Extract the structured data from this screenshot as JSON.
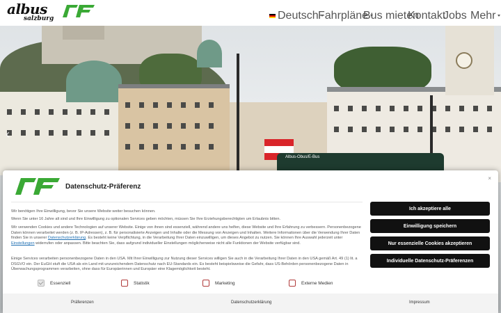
{
  "brand": {
    "logo_text": "albus",
    "logo_sub": "salzburg",
    "accent_green": "#3aa935",
    "logo_icon": "jf-logo-icon"
  },
  "nav": {
    "language": "Deutsch",
    "items": [
      "Fahrpläne",
      "Bus mieten",
      "Kontakt",
      "Jobs",
      "Mehr"
    ]
  },
  "hero": {
    "bus_display": "Albus-Obus/E-Bus"
  },
  "privacy": {
    "title": "Datenschutz-Präferenz",
    "close": "×",
    "p1": "Wir benötigen Ihre Einwilligung, bevor Sie unsere Website weiter besuchen können.",
    "p2": "Wenn Sie unter 16 Jahre alt sind und Ihre Einwilligung zu optionalen Services geben möchten, müssen Sie Ihre Erziehungsberechtigten um Erlaubnis bitten.",
    "p3_a": "Wir verwenden Cookies und andere Technologien auf unserer Website. Einige von ihnen sind essenziell, während andere uns helfen, diese Website und Ihre Erfahrung zu verbessern. Personenbezogene Daten können verarbeitet werden (z. B. IP-Adressen), z. B. für personalisierte Anzeigen und Inhalte oder die Messung von Anzeigen und Inhalten. Weitere Informationen über die Verwendung Ihrer Daten finden Sie in unserer",
    "p3_link1": "Datenschutzerklärung",
    "p3_b": ". Es besteht keine Verpflichtung, in die Verarbeitung Ihrer Daten einzuwilligen, um dieses Angebot zu nutzen. Sie können Ihre Auswahl jederzeit unter",
    "p3_link2": "Einstellungen",
    "p3_c": "widerrufen oder anpassen. Bitte beachten Sie, dass aufgrund individueller Einstellungen möglicherweise nicht alle Funktionen der Website verfügbar sind.",
    "p4": "Einige Services verarbeiten personenbezogene Daten in den USA. Mit Ihrer Einwilligung zur Nutzung dieser Services willigen Sie auch in die Verarbeitung Ihrer Daten in den USA gemäß Art. 49 (1) lit. a DSGVO ein. Der EuGH stuft die USA als ein Land mit unzureichendem Datenschutz nach EU-Standards ein. Es besteht beispielsweise die Gefahr, dass US-Behörden personenbezogene Daten in Überwachungsprogrammen verarbeiten, ohne dass für Europäerinnen und Europäer eine Klagemöglichkeit besteht.",
    "buttons": {
      "accept_all": "Ich akzeptiere alle",
      "save": "Einwilligung speichern",
      "essential": "Nur essenzielle Cookies akzeptieren",
      "individual": "Individuelle Datenschutz-Präferenzen"
    },
    "categories": [
      {
        "label": "Essenziell",
        "checked": true
      },
      {
        "label": "Statistik",
        "checked": false
      },
      {
        "label": "Marketing",
        "checked": false
      },
      {
        "label": "Externe Medien",
        "checked": false
      }
    ],
    "footer": [
      "Präferenzen",
      "Datenschutzerklärung",
      "Impressum"
    ]
  }
}
